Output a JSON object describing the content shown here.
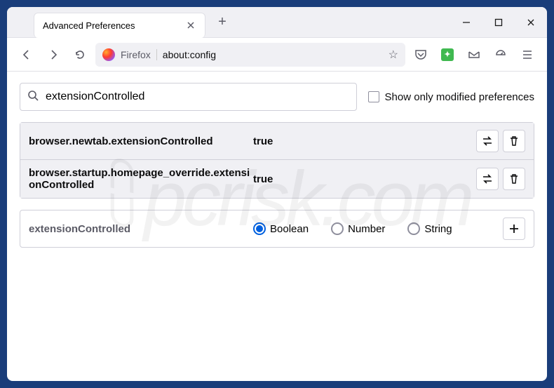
{
  "tab": {
    "title": "Advanced Preferences"
  },
  "urlbar": {
    "firefox_label": "Firefox",
    "url": "about:config"
  },
  "search": {
    "value": "extensionControlled",
    "checkbox_label": "Show only modified preferences"
  },
  "prefs": [
    {
      "name": "browser.newtab.extensionControlled",
      "value": "true"
    },
    {
      "name": "browser.startup.homepage_override.extensionControlled",
      "value": "true"
    }
  ],
  "new_pref": {
    "name": "extensionControlled",
    "types": [
      "Boolean",
      "Number",
      "String"
    ],
    "selected": "Boolean"
  }
}
